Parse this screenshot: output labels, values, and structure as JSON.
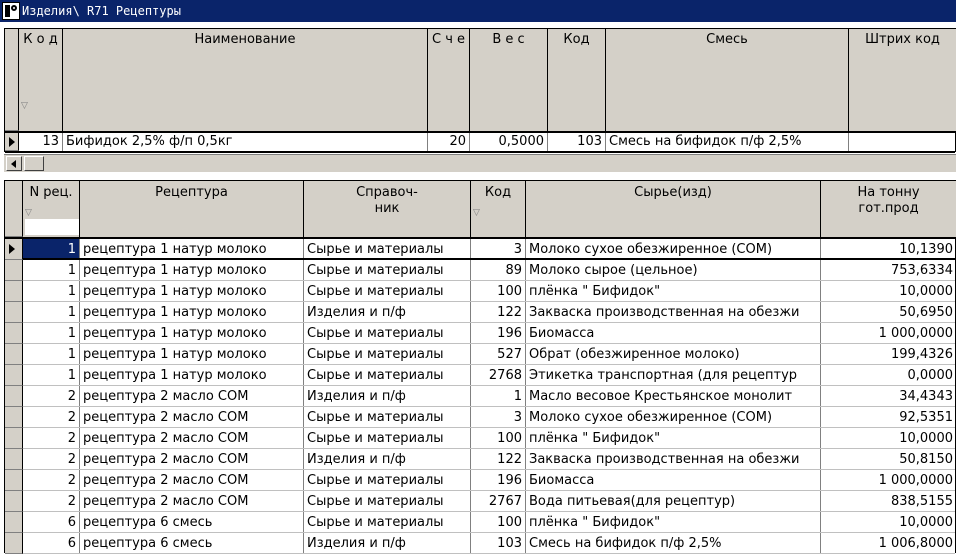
{
  "window": {
    "title": "Изделия\\ R71  Рецептуры"
  },
  "top_grid": {
    "headers": [
      "К о д",
      "Наименование",
      "С ч е",
      "В е с",
      "Код",
      "Смесь",
      "Штрих код"
    ],
    "row": [
      "13",
      "Бифидок 2,5% ф/п 0,5кг",
      "20",
      "0,5000",
      "103",
      "Смесь на бифидок п/ф 2,5%",
      ""
    ]
  },
  "bottom_grid": {
    "headers": [
      "N рец.",
      "Рецептура",
      "Справоч-\nник",
      "Код",
      "Сырье(изд)",
      "На тонну\nгот.прод"
    ],
    "rows": [
      [
        "1",
        "рецептура 1 натур молоко",
        "Сырье и материалы",
        "3",
        "Молоко сухое обезжиренное (СОМ)",
        "10,1390"
      ],
      [
        "1",
        "рецептура 1 натур молоко",
        "Сырье и материалы",
        "89",
        "Молоко сырое (цельное)",
        "753,6334"
      ],
      [
        "1",
        "рецептура 1 натур молоко",
        "Сырье и материалы",
        "100",
        "плёнка \" Бифидок\"",
        "10,0000"
      ],
      [
        "1",
        "рецептура 1 натур молоко",
        "Изделия и п/ф",
        "122",
        "Закваска производственная на обезжи",
        "50,6950"
      ],
      [
        "1",
        "рецептура 1 натур молоко",
        "Сырье и материалы",
        "196",
        "Биомасса",
        "1 000,0000"
      ],
      [
        "1",
        "рецептура 1 натур молоко",
        "Сырье и материалы",
        "527",
        "Обрат (обезжиренное молоко)",
        "199,4326"
      ],
      [
        "1",
        "рецептура 1 натур молоко",
        "Сырье и материалы",
        "2768",
        "Этикетка транспортная (для рецептур",
        "0,0000"
      ],
      [
        "2",
        "рецептура 2 масло СОМ",
        "Изделия и п/ф",
        "1",
        "Масло весовое Крестьянское монолит",
        "34,4343"
      ],
      [
        "2",
        "рецептура 2 масло СОМ",
        "Сырье и материалы",
        "3",
        "Молоко сухое обезжиренное (СОМ)",
        "92,5351"
      ],
      [
        "2",
        "рецептура 2 масло СОМ",
        "Сырье и материалы",
        "100",
        "плёнка \" Бифидок\"",
        "10,0000"
      ],
      [
        "2",
        "рецептура 2 масло СОМ",
        "Изделия и п/ф",
        "122",
        "Закваска производственная на обезжи",
        "50,8150"
      ],
      [
        "2",
        "рецептура 2 масло СОМ",
        "Сырье и материалы",
        "196",
        "Биомасса",
        "1 000,0000"
      ],
      [
        "2",
        "рецептура 2 масло СОМ",
        "Сырье и материалы",
        "2767",
        "Вода питьевая(для рецептур)",
        "838,5155"
      ],
      [
        "6",
        "рецептура 6 смесь",
        "Сырье и материалы",
        "100",
        "плёнка \" Бифидок\"",
        "10,0000"
      ],
      [
        "6",
        "рецептура 6 смесь",
        "Изделия и п/ф",
        "103",
        "Смесь на бифидок п/ф 2,5%",
        "1 006,8000"
      ]
    ]
  },
  "colors": {
    "titlebar": "#0a246a",
    "header": "#d4d0c8",
    "selection": "#0a246a"
  }
}
